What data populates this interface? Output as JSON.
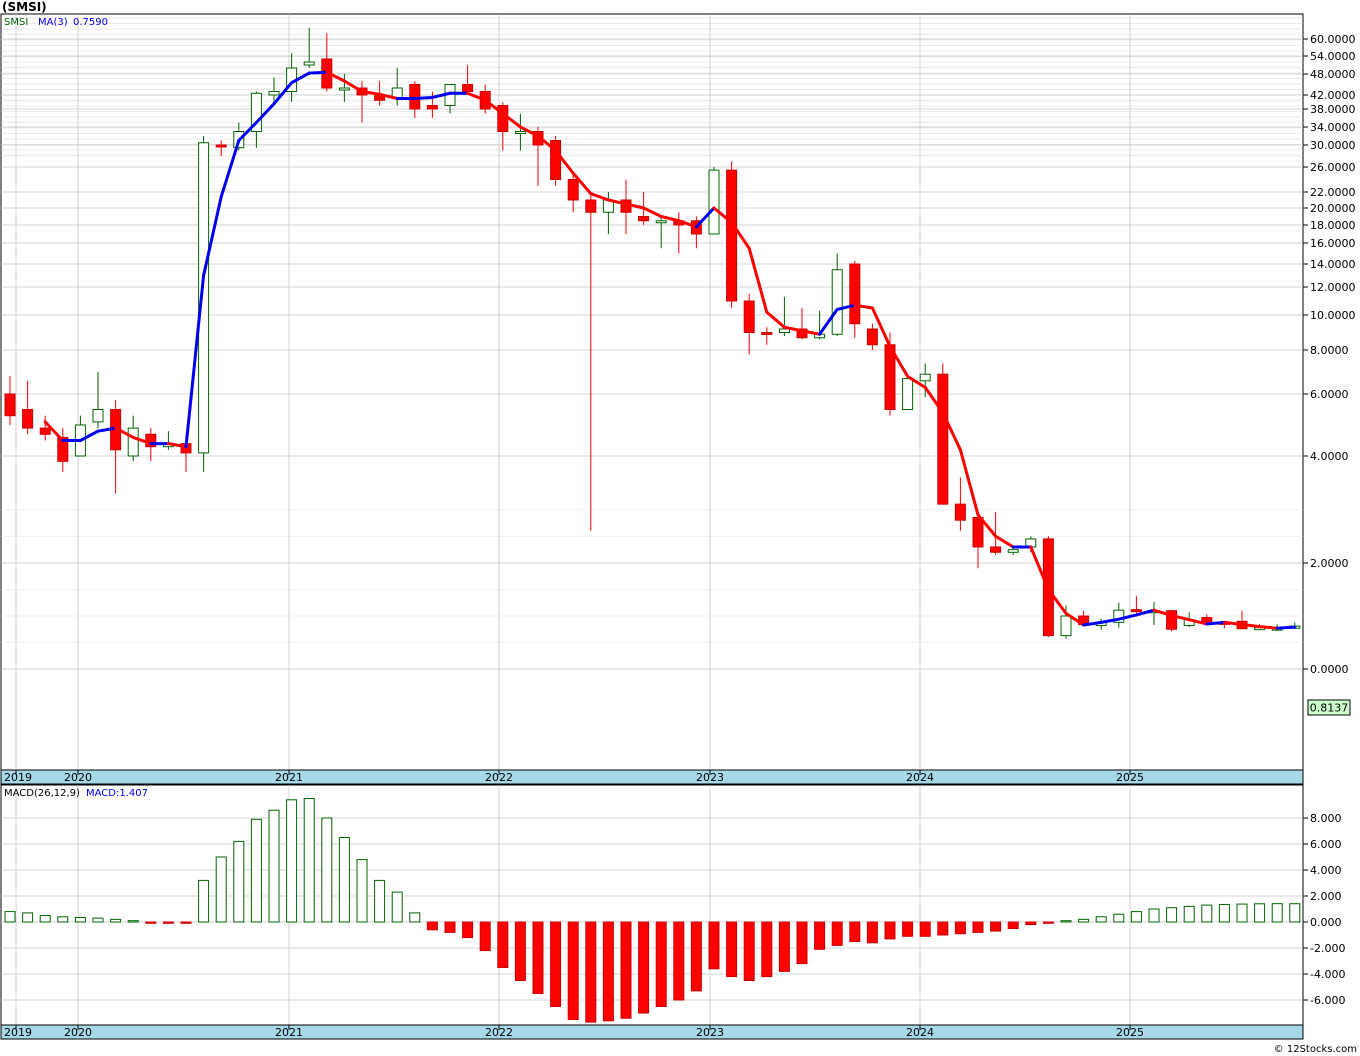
{
  "header": {
    "symbol": "(SMSI)"
  },
  "footer": {
    "copyright": "© 12Stocks.com"
  },
  "chart_data": [
    {
      "type": "candlestick",
      "legend": {
        "symbol": "SMSI",
        "ma_label": "MA(3)",
        "ma_value": "0.7590"
      },
      "last_price_label": "0.8137",
      "y_tick_labels": [
        "60.0000",
        "54.0000",
        "48.0000",
        "42.0000",
        "38.0000",
        "34.0000",
        "30.0000",
        "26.0000",
        "22.0000",
        "20.0000",
        "18.0000",
        "16.0000",
        "14.0000",
        "12.0000",
        "10.0000",
        "8.0000",
        "6.0000",
        "4.0000",
        "2.0000",
        "0.0000"
      ],
      "x_year_labels": [
        "2019",
        "2020",
        "2021",
        "2022",
        "2023",
        "2024",
        "2025"
      ],
      "candles": [
        {
          "o": 6.0,
          "h": 6.8,
          "l": 5.0,
          "c": 5.3
        },
        {
          "o": 5.5,
          "h": 6.6,
          "l": 4.7,
          "c": 4.9
        },
        {
          "o": 4.9,
          "h": 5.3,
          "l": 4.5,
          "c": 4.7
        },
        {
          "o": 4.6,
          "h": 4.9,
          "l": 3.7,
          "c": 3.9
        },
        {
          "o": 4.0,
          "h": 5.3,
          "l": 4.0,
          "c": 5.0
        },
        {
          "o": 5.1,
          "h": 7.0,
          "l": 4.9,
          "c": 5.5
        },
        {
          "o": 5.5,
          "h": 5.8,
          "l": 3.3,
          "c": 4.2
        },
        {
          "o": 4.0,
          "h": 5.3,
          "l": 3.9,
          "c": 4.9
        },
        {
          "o": 4.7,
          "h": 4.9,
          "l": 3.9,
          "c": 4.3
        },
        {
          "o": 4.3,
          "h": 4.8,
          "l": 4.2,
          "c": 4.4
        },
        {
          "o": 4.4,
          "h": 4.7,
          "l": 3.7,
          "c": 4.1
        },
        {
          "o": 4.1,
          "h": 32.0,
          "l": 3.7,
          "c": 30.5
        },
        {
          "o": 30.0,
          "h": 31.0,
          "l": 28.0,
          "c": 29.7
        },
        {
          "o": 29.5,
          "h": 35.0,
          "l": 29.0,
          "c": 33.0
        },
        {
          "o": 33.0,
          "h": 43.0,
          "l": 29.5,
          "c": 42.5
        },
        {
          "o": 42.0,
          "h": 47.0,
          "l": 39.0,
          "c": 43.0
        },
        {
          "o": 43.0,
          "h": 55.0,
          "l": 40.0,
          "c": 50.0
        },
        {
          "o": 51.0,
          "h": 64.0,
          "l": 50.0,
          "c": 52.0
        },
        {
          "o": 53.0,
          "h": 62.0,
          "l": 43.0,
          "c": 44.0
        },
        {
          "o": 44.0,
          "h": 48.0,
          "l": 40.0,
          "c": 44.0
        },
        {
          "o": 44.0,
          "h": 46.0,
          "l": 35.0,
          "c": 42.0
        },
        {
          "o": 42.0,
          "h": 46.0,
          "l": 39.0,
          "c": 40.5
        },
        {
          "o": 41.0,
          "h": 50.0,
          "l": 39.0,
          "c": 44.0
        },
        {
          "o": 45.0,
          "h": 46.0,
          "l": 36.0,
          "c": 38.0
        },
        {
          "o": 39.0,
          "h": 43.0,
          "l": 36.0,
          "c": 38.0
        },
        {
          "o": 39.0,
          "h": 45.0,
          "l": 37.0,
          "c": 45.0
        },
        {
          "o": 45.0,
          "h": 51.0,
          "l": 43.0,
          "c": 43.0
        },
        {
          "o": 43.0,
          "h": 45.0,
          "l": 37.0,
          "c": 38.0
        },
        {
          "o": 39.0,
          "h": 40.0,
          "l": 29.0,
          "c": 33.0
        },
        {
          "o": 33.0,
          "h": 37.0,
          "l": 29.0,
          "c": 33.0
        },
        {
          "o": 33.0,
          "h": 34.0,
          "l": 23.0,
          "c": 30.0
        },
        {
          "o": 31.0,
          "h": 32.0,
          "l": 23.0,
          "c": 24.0
        },
        {
          "o": 24.0,
          "h": 25.0,
          "l": 19.5,
          "c": 21.0
        },
        {
          "o": 21.0,
          "h": 22.0,
          "l": 2.6,
          "c": 19.5
        },
        {
          "o": 19.5,
          "h": 22.0,
          "l": 17.0,
          "c": 21.0
        },
        {
          "o": 21.0,
          "h": 24.0,
          "l": 17.0,
          "c": 19.5
        },
        {
          "o": 19.0,
          "h": 22.0,
          "l": 18.0,
          "c": 18.5
        },
        {
          "o": 18.5,
          "h": 19.0,
          "l": 15.5,
          "c": 18.5
        },
        {
          "o": 18.5,
          "h": 19.5,
          "l": 15.0,
          "c": 18.0
        },
        {
          "o": 18.5,
          "h": 19.0,
          "l": 15.5,
          "c": 17.0
        },
        {
          "o": 17.0,
          "h": 26.0,
          "l": 17.0,
          "c": 25.5
        },
        {
          "o": 25.5,
          "h": 27.0,
          "l": 10.5,
          "c": 11.0
        },
        {
          "o": 11.0,
          "h": 11.5,
          "l": 7.8,
          "c": 9.0
        },
        {
          "o": 9.0,
          "h": 9.3,
          "l": 8.3,
          "c": 8.9
        },
        {
          "o": 9.0,
          "h": 11.3,
          "l": 8.8,
          "c": 9.2
        },
        {
          "o": 9.2,
          "h": 10.5,
          "l": 8.6,
          "c": 8.7
        },
        {
          "o": 8.7,
          "h": 10.3,
          "l": 8.6,
          "c": 8.9
        },
        {
          "o": 8.9,
          "h": 15.0,
          "l": 8.8,
          "c": 13.5
        },
        {
          "o": 14.0,
          "h": 14.3,
          "l": 8.7,
          "c": 9.5
        },
        {
          "o": 9.2,
          "h": 9.5,
          "l": 8.0,
          "c": 8.3
        },
        {
          "o": 8.3,
          "h": 9.0,
          "l": 5.3,
          "c": 5.5
        },
        {
          "o": 5.5,
          "h": 6.8,
          "l": 5.5,
          "c": 6.7
        },
        {
          "o": 6.6,
          "h": 7.4,
          "l": 5.9,
          "c": 6.9
        },
        {
          "o": 6.9,
          "h": 7.4,
          "l": 3.1,
          "c": 3.1
        },
        {
          "o": 3.1,
          "h": 3.6,
          "l": 2.6,
          "c": 2.8
        },
        {
          "o": 2.85,
          "h": 2.9,
          "l": 1.9,
          "c": 2.3
        },
        {
          "o": 2.3,
          "h": 2.95,
          "l": 2.15,
          "c": 2.2
        },
        {
          "o": 2.2,
          "h": 2.3,
          "l": 2.15,
          "c": 2.25
        },
        {
          "o": 2.3,
          "h": 2.5,
          "l": 2.2,
          "c": 2.45
        },
        {
          "o": 2.45,
          "h": 2.5,
          "l": 0.6,
          "c": 0.63
        },
        {
          "o": 0.63,
          "h": 1.2,
          "l": 0.57,
          "c": 1.0
        },
        {
          "o": 1.0,
          "h": 1.1,
          "l": 0.83,
          "c": 0.84
        },
        {
          "o": 0.82,
          "h": 0.95,
          "l": 0.74,
          "c": 0.88
        },
        {
          "o": 0.88,
          "h": 1.25,
          "l": 0.78,
          "c": 1.11
        },
        {
          "o": 1.12,
          "h": 1.38,
          "l": 1.05,
          "c": 1.09
        },
        {
          "o": 1.1,
          "h": 1.27,
          "l": 0.83,
          "c": 1.1
        },
        {
          "o": 1.1,
          "h": 1.12,
          "l": 0.71,
          "c": 0.75
        },
        {
          "o": 0.82,
          "h": 1.07,
          "l": 0.79,
          "c": 0.93
        },
        {
          "o": 0.97,
          "h": 1.03,
          "l": 0.86,
          "c": 0.88
        },
        {
          "o": 0.88,
          "h": 0.9,
          "l": 0.77,
          "c": 0.86
        },
        {
          "o": 0.9,
          "h": 1.1,
          "l": 0.76,
          "c": 0.76
        },
        {
          "o": 0.77,
          "h": 0.85,
          "l": 0.74,
          "c": 0.78
        },
        {
          "o": 0.77,
          "h": 0.84,
          "l": 0.77,
          "c": 0.77
        },
        {
          "o": 0.77,
          "h": 0.88,
          "l": 0.76,
          "c": 0.81
        }
      ],
      "ma3": [
        null,
        null,
        5.1,
        4.5,
        4.5,
        4.8,
        4.9,
        4.6,
        4.4,
        4.4,
        4.3,
        13.0,
        21.4,
        31.0,
        35.0,
        39.5,
        45.5,
        48.3,
        48.6,
        46.0,
        43.0,
        42.2,
        41.0,
        41.0,
        41.3,
        42.5,
        42.5,
        40.5,
        37.0,
        34.0,
        32.0,
        29.0,
        25.0,
        21.8,
        21.0,
        20.5,
        20.0,
        19.0,
        18.5,
        17.8,
        20.0,
        18.3,
        15.5,
        10.2,
        9.3,
        9.1,
        8.9,
        10.4,
        10.7,
        10.5,
        8.2,
        6.8,
        6.3,
        5.4,
        4.2,
        2.9,
        2.5,
        2.3,
        2.3,
        1.5,
        1.05,
        0.83,
        0.88,
        0.94,
        1.02,
        1.11,
        1.01,
        0.93,
        0.85,
        0.88,
        0.84,
        0.8,
        0.77,
        0.79
      ],
      "colors": {
        "up": "#006400",
        "down": "#ff0000",
        "ma_up": "#0000ee",
        "ma_down": "#ff0000",
        "price_box": "#ccffcc"
      }
    },
    {
      "type": "bar",
      "legend": {
        "name": "MACD(26,12,9)",
        "value_label": "MACD:1.407"
      },
      "y_tick_labels": [
        "8.000",
        "6.000",
        "4.000",
        "2.000",
        "0.000",
        "-2.000",
        "-4.000",
        "-6.000"
      ],
      "ylim": [
        -7.7,
        9.6
      ],
      "values": [
        0.8,
        0.7,
        0.5,
        0.4,
        0.35,
        0.3,
        0.2,
        0.1,
        -0.1,
        -0.1,
        -0.1,
        3.2,
        5.0,
        6.2,
        7.9,
        8.6,
        9.4,
        9.5,
        8.0,
        6.5,
        4.8,
        3.2,
        2.3,
        0.7,
        -0.6,
        -0.8,
        -1.2,
        -2.2,
        -3.5,
        -4.5,
        -5.5,
        -6.5,
        -7.5,
        -7.7,
        -7.6,
        -7.4,
        -7.0,
        -6.5,
        -6.0,
        -5.3,
        -3.6,
        -4.2,
        -4.5,
        -4.2,
        -3.8,
        -3.2,
        -2.1,
        -1.8,
        -1.5,
        -1.6,
        -1.3,
        -1.1,
        -1.1,
        -1.0,
        -0.9,
        -0.8,
        -0.7,
        -0.5,
        -0.2,
        -0.1,
        0.1,
        0.2,
        0.4,
        0.6,
        0.8,
        1.0,
        1.1,
        1.2,
        1.3,
        1.35,
        1.38,
        1.4,
        1.41,
        1.407
      ]
    }
  ]
}
